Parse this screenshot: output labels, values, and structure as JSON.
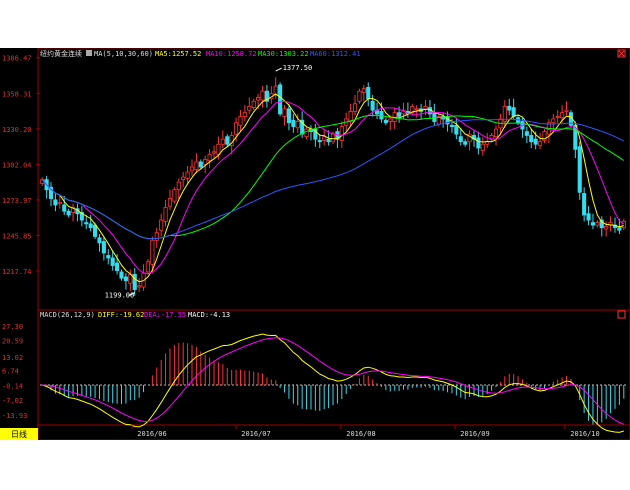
{
  "chart_data": [
    {
      "type": "candlestick",
      "title": "纽约黄金连续",
      "indicator_label": "MA(5,10,30,60)",
      "period_button": "日线",
      "legend": [
        {
          "text": "MA5:1257.52",
          "color": "#ffff00"
        },
        {
          "text": "MA10:1258.72",
          "color": "#ff00ff"
        },
        {
          "text": "MA30:1303.22",
          "color": "#00ff00"
        },
        {
          "text": "MA60:1312.41",
          "color": "#3355ff"
        }
      ],
      "y_ticks": [
        "1386.47",
        "1358.31",
        "1330.20",
        "1302.04",
        "1273.97",
        "1245.85",
        "1217.74"
      ],
      "ylim": [
        1190,
        1391
      ],
      "x_ticks": [
        "2016/06",
        "2016/07",
        "2016/08",
        "2016/09",
        "2016/10"
      ],
      "annotations": {
        "max": "1377.50",
        "min": "1199.00"
      },
      "closes": [
        1290,
        1282,
        1275,
        1270,
        1272,
        1265,
        1262,
        1268,
        1263,
        1258,
        1255,
        1252,
        1245,
        1240,
        1232,
        1228,
        1222,
        1218,
        1212,
        1210,
        1215,
        1203,
        1206,
        1216,
        1225,
        1242,
        1248,
        1258,
        1268,
        1275,
        1282,
        1288,
        1292,
        1296,
        1300,
        1304,
        1300,
        1306,
        1310,
        1312,
        1318,
        1322,
        1318,
        1325,
        1335,
        1340,
        1343,
        1348,
        1352,
        1355,
        1360,
        1352,
        1358,
        1364,
        1342,
        1346,
        1335,
        1332,
        1336,
        1326,
        1330,
        1328,
        1322,
        1320,
        1324,
        1320,
        1326,
        1322,
        1332,
        1338,
        1344,
        1350,
        1360,
        1362,
        1354,
        1345,
        1342,
        1338,
        1335,
        1338,
        1343,
        1340,
        1345,
        1342,
        1348,
        1346,
        1344,
        1348,
        1342,
        1336,
        1340,
        1338,
        1334,
        1332,
        1326,
        1320,
        1318,
        1326,
        1322,
        1315,
        1318,
        1320,
        1325,
        1330,
        1338,
        1348,
        1345,
        1340,
        1335,
        1330,
        1325,
        1320,
        1318,
        1320,
        1328,
        1335,
        1338,
        1340,
        1343,
        1345,
        1333,
        1314,
        1280,
        1262,
        1258,
        1254,
        1256,
        1252,
        1253,
        1256,
        1252,
        1250,
        1257
      ]
    },
    {
      "type": "macd",
      "title": "MACD(26,12,9)",
      "legend": [
        {
          "text": "DIFF:-19.62",
          "color": "#ffff00"
        },
        {
          "text": "DEA:-17.55",
          "color": "#ff00ff"
        },
        {
          "text": "MACD:-4.13",
          "color": "#ffffff"
        }
      ],
      "y_ticks": [
        "27.30",
        "20.59",
        "13.02",
        "6.74",
        "-0.14",
        "-7.02",
        "-13.93"
      ],
      "ylim": [
        -18,
        30
      ]
    }
  ]
}
